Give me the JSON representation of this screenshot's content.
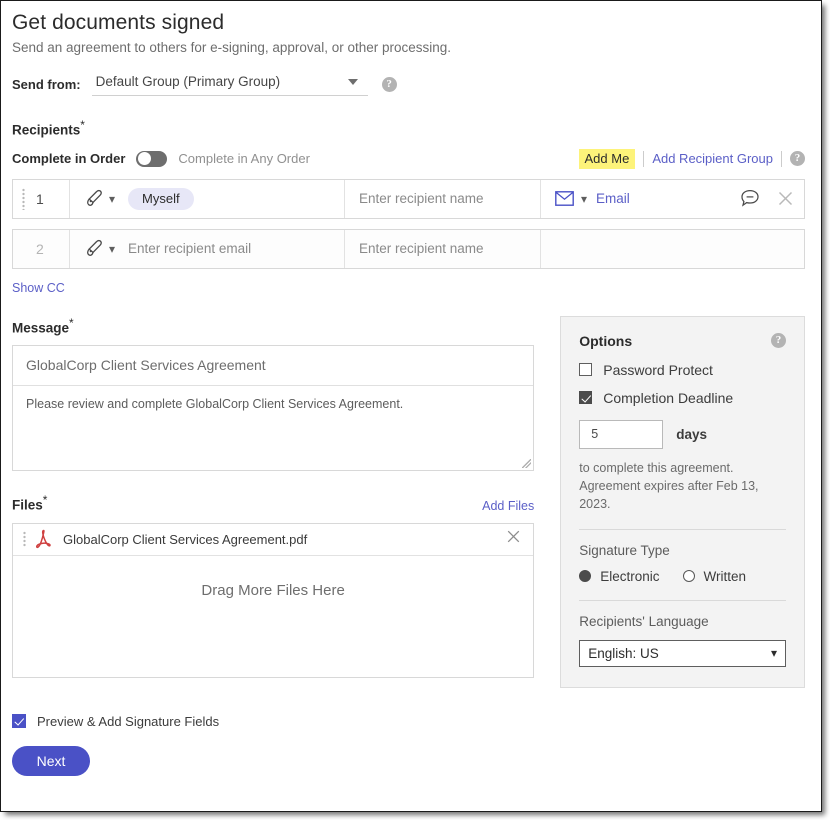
{
  "header": {
    "title": "Get documents signed",
    "subtitle": "Send an agreement to others for e-signing, approval, or other processing.",
    "send_from_label": "Send from:",
    "send_from_value": "Default Group (Primary Group)",
    "help_glyph": "?"
  },
  "recipients": {
    "section_label": "Recipients",
    "required_marker": "*",
    "order_on_label": "Complete in Order",
    "order_off_label": "Complete in Any Order",
    "add_me_label": "Add Me",
    "add_recipient_group_label": "Add Recipient Group",
    "show_cc_label": "Show CC",
    "rows": [
      {
        "number": "1",
        "email_value": "Myself",
        "name_placeholder": "Enter recipient name",
        "method_label": "Email"
      },
      {
        "number": "2",
        "email_placeholder": "Enter recipient email",
        "name_placeholder": "Enter recipient name"
      }
    ]
  },
  "message": {
    "section_label": "Message",
    "required_marker": "*",
    "subject": "GlobalCorp Client Services Agreement",
    "body": "Please review and complete GlobalCorp Client Services Agreement."
  },
  "files": {
    "section_label": "Files",
    "required_marker": "*",
    "add_files_label": "Add Files",
    "items": [
      {
        "name": "GlobalCorp Client Services Agreement.pdf"
      }
    ],
    "drop_text": "Drag More Files Here"
  },
  "options": {
    "title": "Options",
    "password_protect_label": "Password Protect",
    "password_protect_checked": false,
    "completion_deadline_label": "Completion Deadline",
    "completion_deadline_checked": true,
    "days_value": "5",
    "days_word": "days",
    "note_line1": "to complete this agreement.",
    "note_line2": "Agreement expires after Feb 13, 2023.",
    "signature_type_label": "Signature Type",
    "signature_options": [
      {
        "label": "Electronic",
        "selected": true
      },
      {
        "label": "Written",
        "selected": false
      }
    ],
    "language_label": "Recipients' Language",
    "language_value": "English: US"
  },
  "footer": {
    "preview_label": "Preview & Add Signature Fields",
    "preview_checked": true,
    "next_label": "Next"
  },
  "colors": {
    "accent_blue": "#4a51c6",
    "link_blue": "#5b5fc7",
    "highlight_yellow": "#fdf37a",
    "pdf_red": "#d13b3b",
    "panel_gray": "#f3f3f3"
  }
}
